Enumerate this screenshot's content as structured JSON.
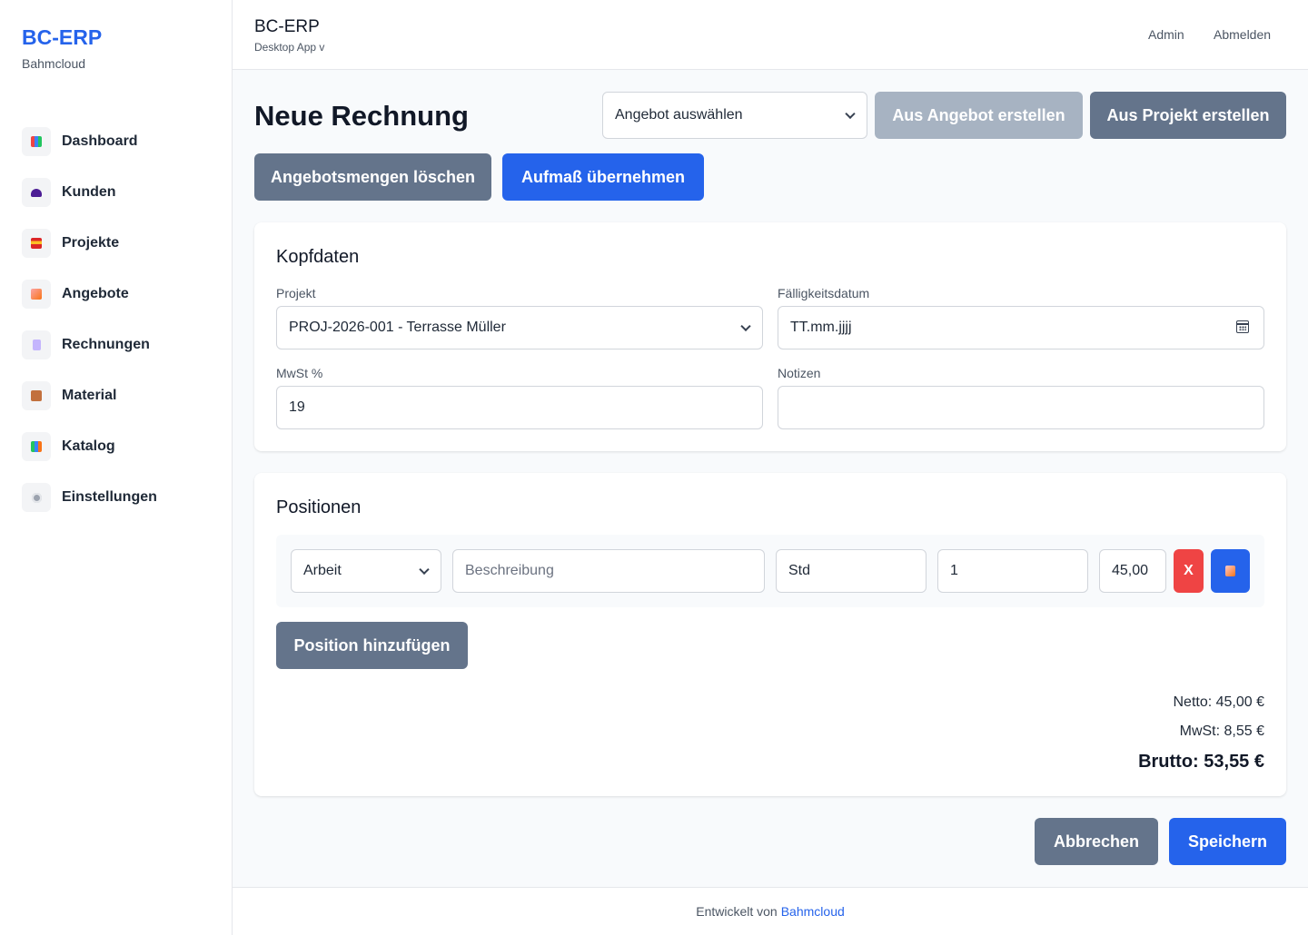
{
  "sidebar": {
    "brand": "BC-ERP",
    "brand_sub": "Bahmcloud",
    "items": [
      {
        "label": "Dashboard",
        "icon": "chart-icon"
      },
      {
        "label": "Kunden",
        "icon": "users-icon"
      },
      {
        "label": "Projekte",
        "icon": "construction-icon"
      },
      {
        "label": "Angebote",
        "icon": "memo-icon"
      },
      {
        "label": "Rechnungen",
        "icon": "receipt-icon"
      },
      {
        "label": "Material",
        "icon": "package-icon"
      },
      {
        "label": "Katalog",
        "icon": "books-icon"
      },
      {
        "label": "Einstellungen",
        "icon": "gear-icon"
      }
    ]
  },
  "topbar": {
    "title": "BC-ERP",
    "subtitle": "Desktop App v",
    "admin": "Admin",
    "logout": "Abmelden"
  },
  "page": {
    "title": "Neue Rechnung",
    "offer_select": "Angebot auswählen",
    "from_offer": "Aus Angebot erstellen",
    "from_project": "Aus Projekt erstellen",
    "clear_offer_qty": "Angebotsmengen löschen",
    "apply_measurement": "Aufmaß übernehmen"
  },
  "header_card": {
    "title": "Kopfdaten",
    "project_label": "Projekt",
    "project_value": "PROJ-2026-001 - Terrasse Müller",
    "due_label": "Fälligkeitsdatum",
    "due_placeholder": "TT.mm.jjjj",
    "vat_label": "MwSt %",
    "vat_value": "19",
    "notes_label": "Notizen",
    "notes_value": ""
  },
  "positions_card": {
    "title": "Positionen",
    "row": {
      "type": "Arbeit",
      "description_placeholder": "Beschreibung",
      "unit": "Std",
      "quantity": "1",
      "price": "45,00",
      "delete_label": "X"
    },
    "add_button": "Position hinzufügen",
    "netto": "Netto: 45,00 €",
    "mwst": "MwSt: 8,55 €",
    "brutto": "Brutto: 53,55 €"
  },
  "actions": {
    "cancel": "Abbrechen",
    "save": "Speichern"
  },
  "footer": {
    "text": "Entwickelt von",
    "link": "Bahmcloud"
  },
  "colors": {
    "primary": "#2563eb",
    "secondary": "#64748b",
    "disabled": "#a7b3c2",
    "danger": "#ef4444"
  }
}
